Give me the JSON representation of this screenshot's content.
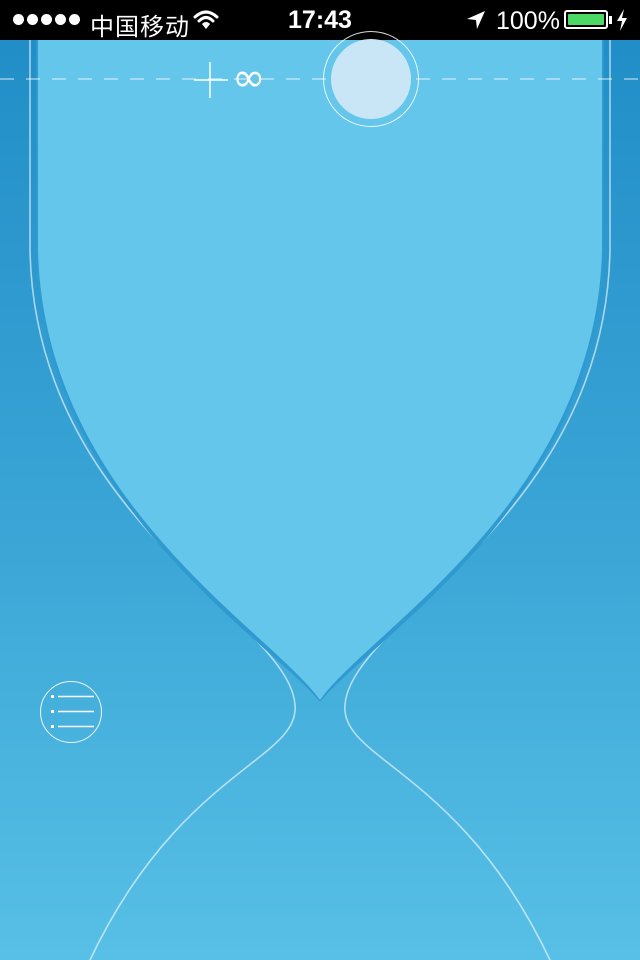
{
  "status_bar": {
    "signal_bars": 5,
    "carrier": "中国移动",
    "time": "17:43",
    "battery_percent": "100%",
    "battery_level": 1.0,
    "icons": [
      "signal-dots-icon",
      "wifi-icon",
      "location-arrow-icon",
      "battery-icon",
      "charging-bolt-icon"
    ]
  },
  "timer": {
    "duration_label": "∞"
  },
  "colors": {
    "background_top": "#1f8cc6",
    "background_bottom": "#58c0e6",
    "sand": "#64c6ea",
    "handle_fill": "#c8e6f5",
    "battery_fill": "#4cd964"
  },
  "controls": {
    "menu_icon": "list-icon",
    "handle_icon": "circle-knob",
    "add_icon": "crosshair-plus-icon"
  }
}
